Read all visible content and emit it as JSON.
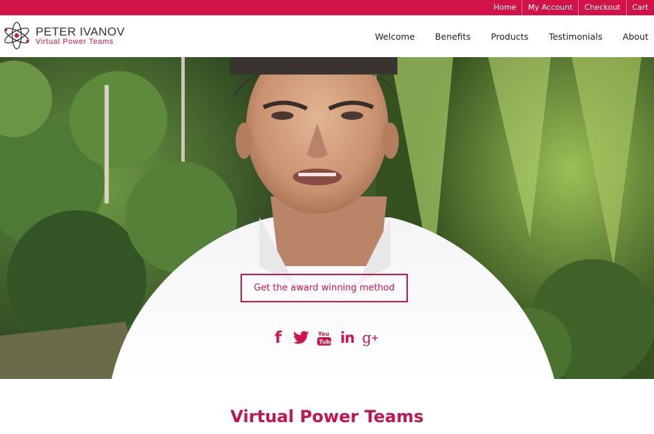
{
  "topbar": {
    "links": [
      "Home",
      "My Account",
      "Checkout",
      "Cart"
    ]
  },
  "brand": {
    "name": "PETER IVANOV",
    "tagline": "Virtual Power Teams"
  },
  "nav": {
    "items": [
      "Welcome",
      "Benefits",
      "Products",
      "Testimonials",
      "About"
    ]
  },
  "hero": {
    "cta_label": "Get the award winning method",
    "social_icons": [
      "facebook-icon",
      "twitter-icon",
      "youtube-icon",
      "linkedin-icon",
      "google-plus-icon"
    ]
  },
  "social": {
    "facebook": "f",
    "linkedin": "in",
    "googleplus": "g",
    "googleplus_sup": "+"
  },
  "section": {
    "title": "Virtual Power Teams"
  },
  "colors": {
    "accent": "#d2134a",
    "heading": "#c4164a",
    "text": "#222222"
  }
}
